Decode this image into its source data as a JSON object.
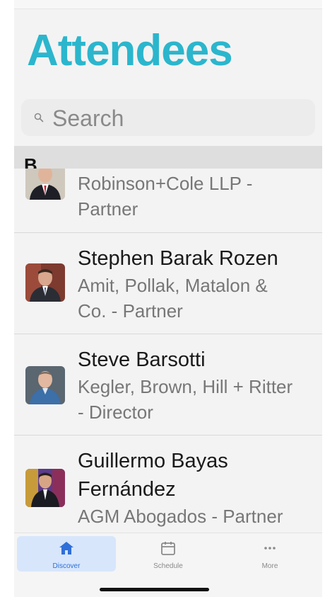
{
  "header": {
    "title": "Attendees"
  },
  "search": {
    "placeholder": "Search"
  },
  "section": {
    "letter": "B"
  },
  "attendees": [
    {
      "name": "",
      "subtitle_line1": "Robinson+Cole LLP -",
      "subtitle_line2": "Partner"
    },
    {
      "name": "Stephen Barak Rozen",
      "subtitle_line1": "Amit, Pollak, Matalon &",
      "subtitle_line2": "Co.  - Partner"
    },
    {
      "name": "Steve Barsotti",
      "subtitle_line1": "Kegler, Brown, Hill + Ritter",
      "subtitle_line2": "- Director"
    },
    {
      "name_line1": "Guillermo Bayas",
      "name_line2": "Fernández",
      "subtitle_line1": "AGM Abogados - Partner"
    }
  ],
  "tabbar": {
    "tabs": [
      {
        "label": "Discover",
        "icon": "home-icon",
        "active": true
      },
      {
        "label": "Schedule",
        "icon": "calendar-icon",
        "active": false
      },
      {
        "label": "More",
        "icon": "more-icon",
        "active": false
      }
    ]
  },
  "colors": {
    "accent": "#2bb6cd",
    "tab_active": "#2f6fd8",
    "tab_active_bg": "#d7e6fb"
  }
}
